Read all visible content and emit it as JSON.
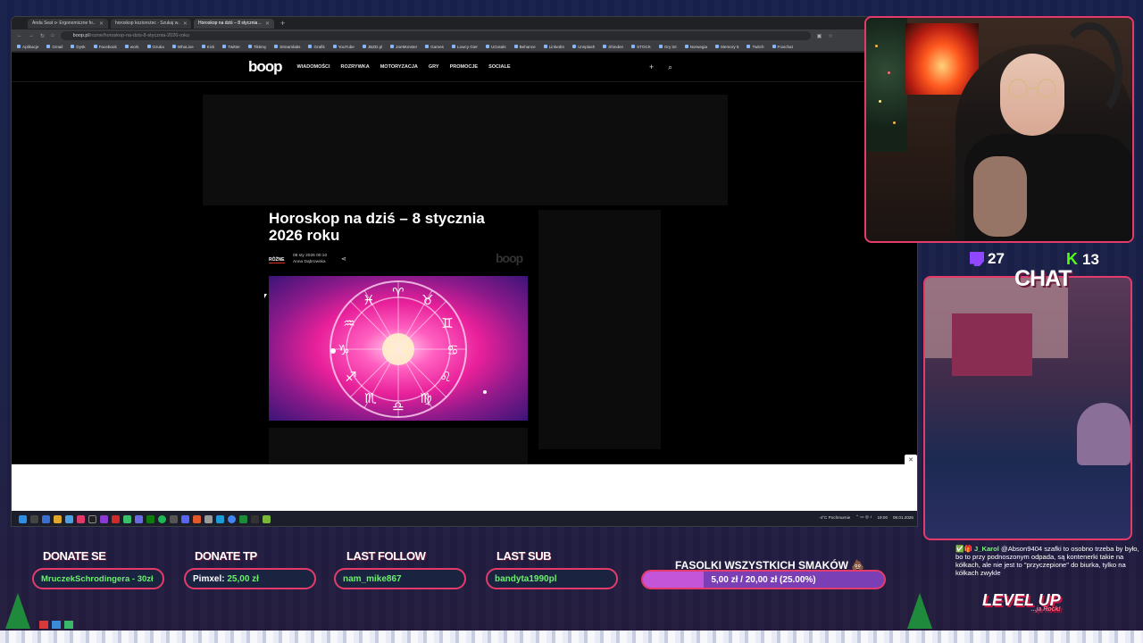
{
  "browser": {
    "tabs": [
      {
        "label": "Anda Seat ⊳ Ergonomiczne fo..",
        "active": false
      },
      {
        "label": "horoskop koziorożec - Szukaj w..",
        "active": false
      },
      {
        "label": "Horoskop na dziś – 8 stycznia ..",
        "active": true
      }
    ],
    "url_host": "boop.pl",
    "url_path": "/rozne/horoskop-na-dzis-8-stycznia-2026-roku",
    "bookmarks": [
      "Aplikacje",
      "Gmail",
      "Dysk",
      "Facebook",
      "work",
      "Ozuka",
      "WhoLive",
      "Kick",
      "Twitter",
      "Tiktimy",
      "Streamlabs",
      "Grafik",
      "YouTube",
      "JBZD.pl",
      "JoeMonster",
      "Games",
      "Lowcy Gier",
      "UGotals",
      "Behance",
      "LinkedIn",
      "Unsplash",
      "Shinden",
      "STOCK",
      "Gry tnt",
      "Norwegia",
      "Memory 5",
      "Twitch",
      "Foxichat"
    ]
  },
  "site": {
    "logo": "boop",
    "nav": [
      "WIADOMOŚCI",
      "ROZRYWKA",
      "MOTORYZACJA",
      "GRY",
      "PROMOCJE",
      "SOCIALE"
    ],
    "article": {
      "title": "Horoskop na dziś – 8 stycznia 2026 roku",
      "category": "RÓŻNE",
      "date": "08 sty 2026 00:10",
      "author": "Anna Dąbrowska",
      "watermark": "boop"
    }
  },
  "taskbar": {
    "weather": "-4°C Pochmurnie",
    "time": "19:00",
    "date": "08.01.2026"
  },
  "stream": {
    "twitch_count": "27",
    "kick_count": "13",
    "chat_label": "CHAT",
    "chat_message": {
      "user": "J_Karol",
      "text": "@Abson9404 szafki to osobno trzeba by było, bo to przy podnoszonym odpada, są kontenerki takie na kółkach, ale nie jest to \"przyczepione\" do biurka, tylko na kółkach zwykle"
    },
    "brand": "LEVEL UP",
    "brand_tag": "...ja Rock!",
    "widgets": [
      {
        "title": "DONATE SE",
        "value": "MruczekSchrodingera - 30zł"
      },
      {
        "title": "DONATE TP",
        "value_name": "Pimxel:",
        "value_amount": "25,00 zł"
      },
      {
        "title": "LAST FOLLOW",
        "value": "nam_mike867"
      },
      {
        "title": "LAST SUB",
        "value": "bandyta1990pl"
      }
    ],
    "goal": {
      "title": "FASOLKI WSZYSTKICH SMAKÓW 💩",
      "text": "5,00 zł / 20,00 zł (25.00%)",
      "progress": 0.25
    }
  },
  "colors": {
    "accent": "#e53b6b",
    "twitch": "#9146ff",
    "kick": "#53fc18"
  }
}
